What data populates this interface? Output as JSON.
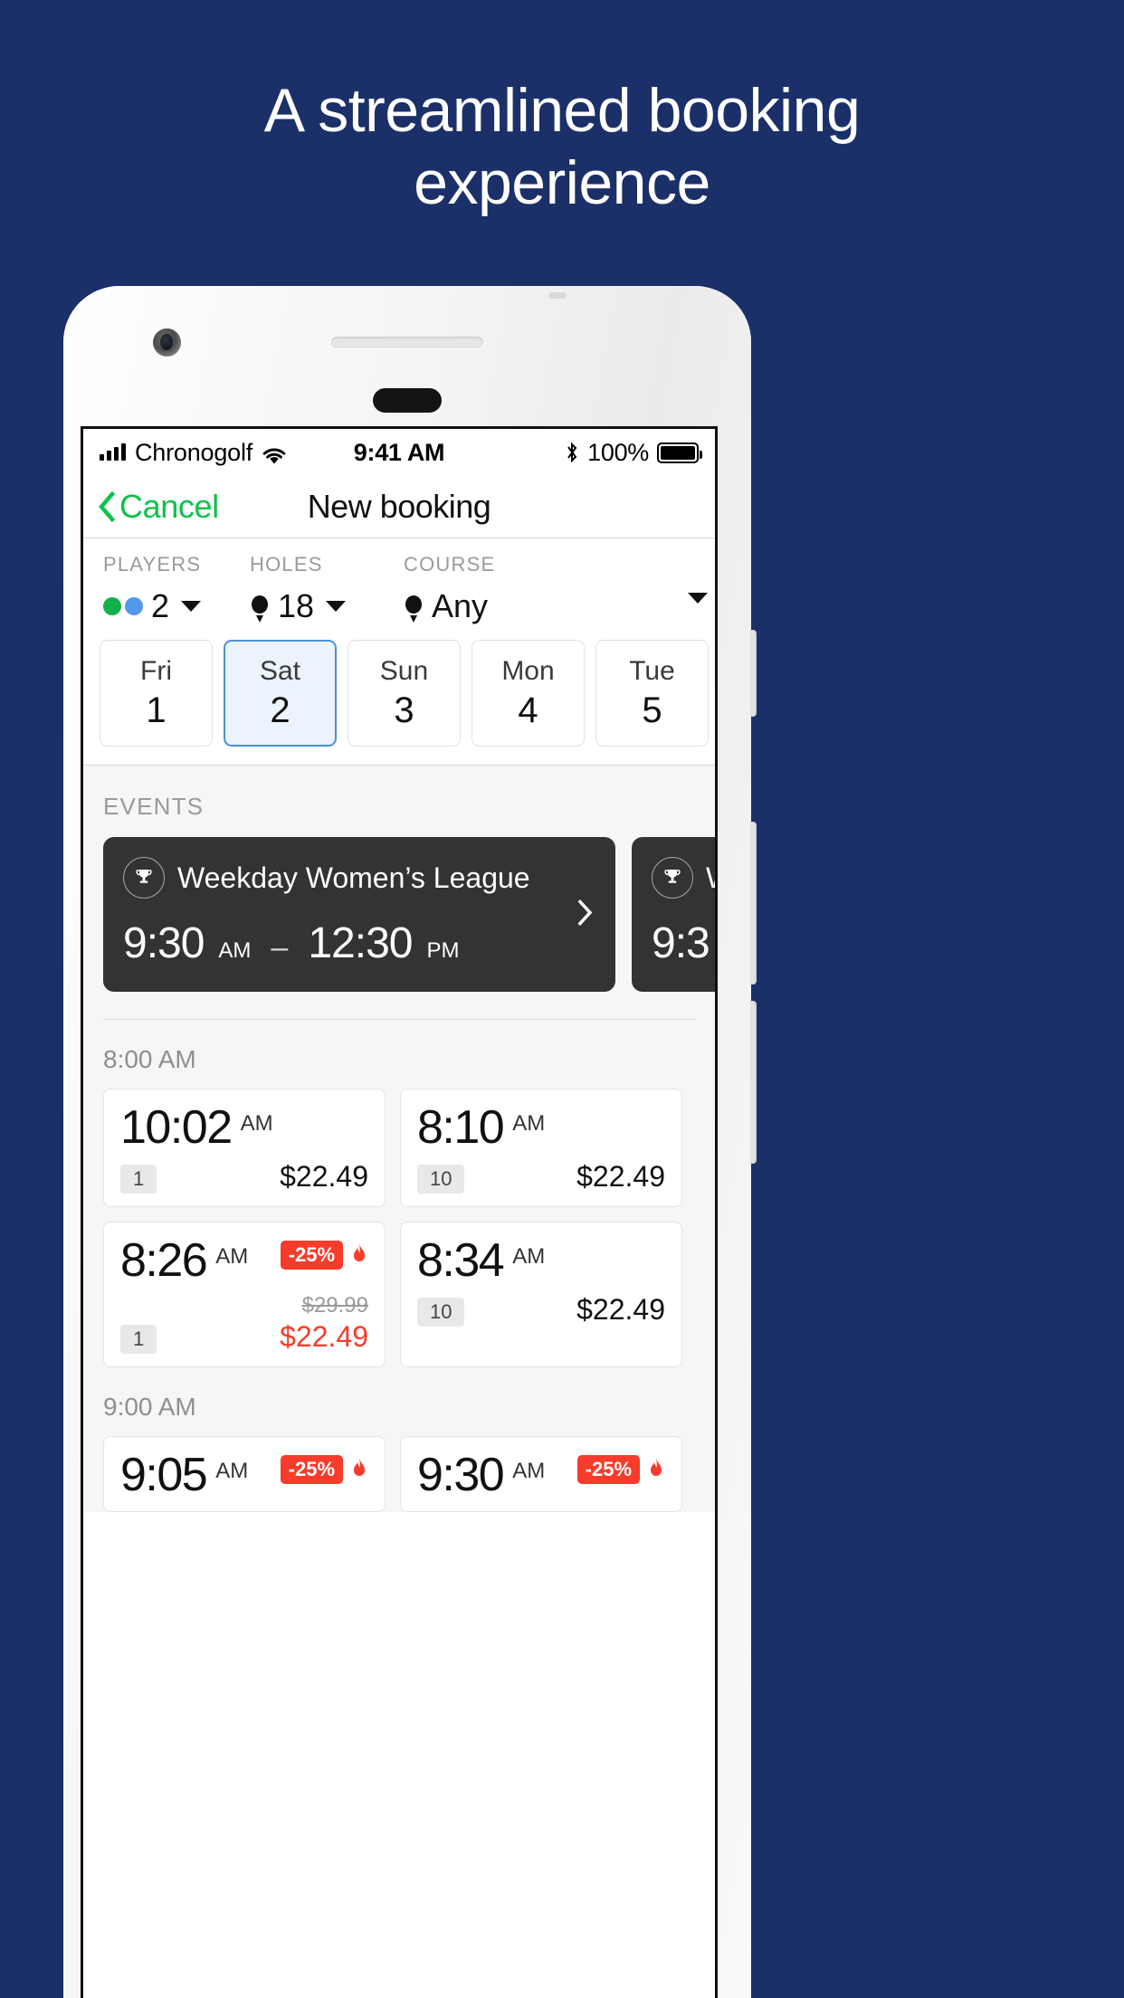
{
  "poster": {
    "headline_line1": "A streamlined booking",
    "headline_line2": "experience",
    "background_color": "#1b3068"
  },
  "status_bar": {
    "carrier": "Chronogolf",
    "signal_icon": "signal-bars-icon",
    "wifi_icon": "wifi-icon",
    "time": "9:41 AM",
    "bluetooth_icon": "bluetooth-icon",
    "battery_percent": "100%",
    "battery_icon": "battery-full-icon"
  },
  "nav_bar": {
    "back_icon": "chevron-left-icon",
    "cancel_label": "Cancel",
    "title": "New booking",
    "accent_color": "#0ec24a"
  },
  "filters": [
    {
      "label": "PLAYERS",
      "value": "2",
      "icon": "player-dots-icon"
    },
    {
      "label": "HOLES",
      "value": "18",
      "icon": "golf-tee-icon"
    },
    {
      "label": "COURSE",
      "value": "Any",
      "icon": "golf-tee-icon"
    }
  ],
  "dates": [
    {
      "dow": "Fri",
      "day": "1",
      "selected": false
    },
    {
      "dow": "Sat",
      "day": "2",
      "selected": true
    },
    {
      "dow": "Sun",
      "day": "3",
      "selected": false
    },
    {
      "dow": "Mon",
      "day": "4",
      "selected": false
    },
    {
      "dow": "Tue",
      "day": "5",
      "selected": false
    }
  ],
  "events": {
    "section_label": "EVENTS",
    "items": [
      {
        "icon": "trophy-icon",
        "name": "Weekday Women’s League",
        "start_time": "9:30",
        "start_meridiem": "AM",
        "dash": "–",
        "end_time": "12:30",
        "end_meridiem": "PM",
        "chevron": "chevron-right-icon"
      },
      {
        "icon": "trophy-icon",
        "name": "W",
        "start_time": "9:3",
        "start_meridiem": "",
        "dash": "",
        "end_time": "",
        "end_meridiem": ""
      }
    ]
  },
  "tee_sections": [
    {
      "header": "8:00 AM",
      "slots": [
        {
          "time": "10:02",
          "meridiem": "AM",
          "count": "1",
          "price": "$22.49",
          "old_price": "",
          "discount": "",
          "hot": false
        },
        {
          "time": "8:10",
          "meridiem": "AM",
          "count": "10",
          "price": "$22.49",
          "old_price": "",
          "discount": "",
          "hot": false
        },
        {
          "time": "8:26",
          "meridiem": "AM",
          "count": "1",
          "price": "$22.49",
          "old_price": "$29.99",
          "discount": "-25%",
          "hot": true
        },
        {
          "time": "8:34",
          "meridiem": "AM",
          "count": "10",
          "price": "$22.49",
          "old_price": "",
          "discount": "",
          "hot": false
        }
      ]
    },
    {
      "header": "9:00 AM",
      "slots": [
        {
          "time": "9:05",
          "meridiem": "AM",
          "count": "",
          "price": "",
          "old_price": "",
          "discount": "-25%",
          "hot": true
        },
        {
          "time": "9:30",
          "meridiem": "AM",
          "count": "",
          "price": "",
          "old_price": "",
          "discount": "-25%",
          "hot": true
        }
      ]
    }
  ],
  "colors": {
    "accent_green": "#0ec24a",
    "selected_blue": "#4a90d9",
    "sale_red": "#f73c2b",
    "event_dark": "#333333"
  }
}
